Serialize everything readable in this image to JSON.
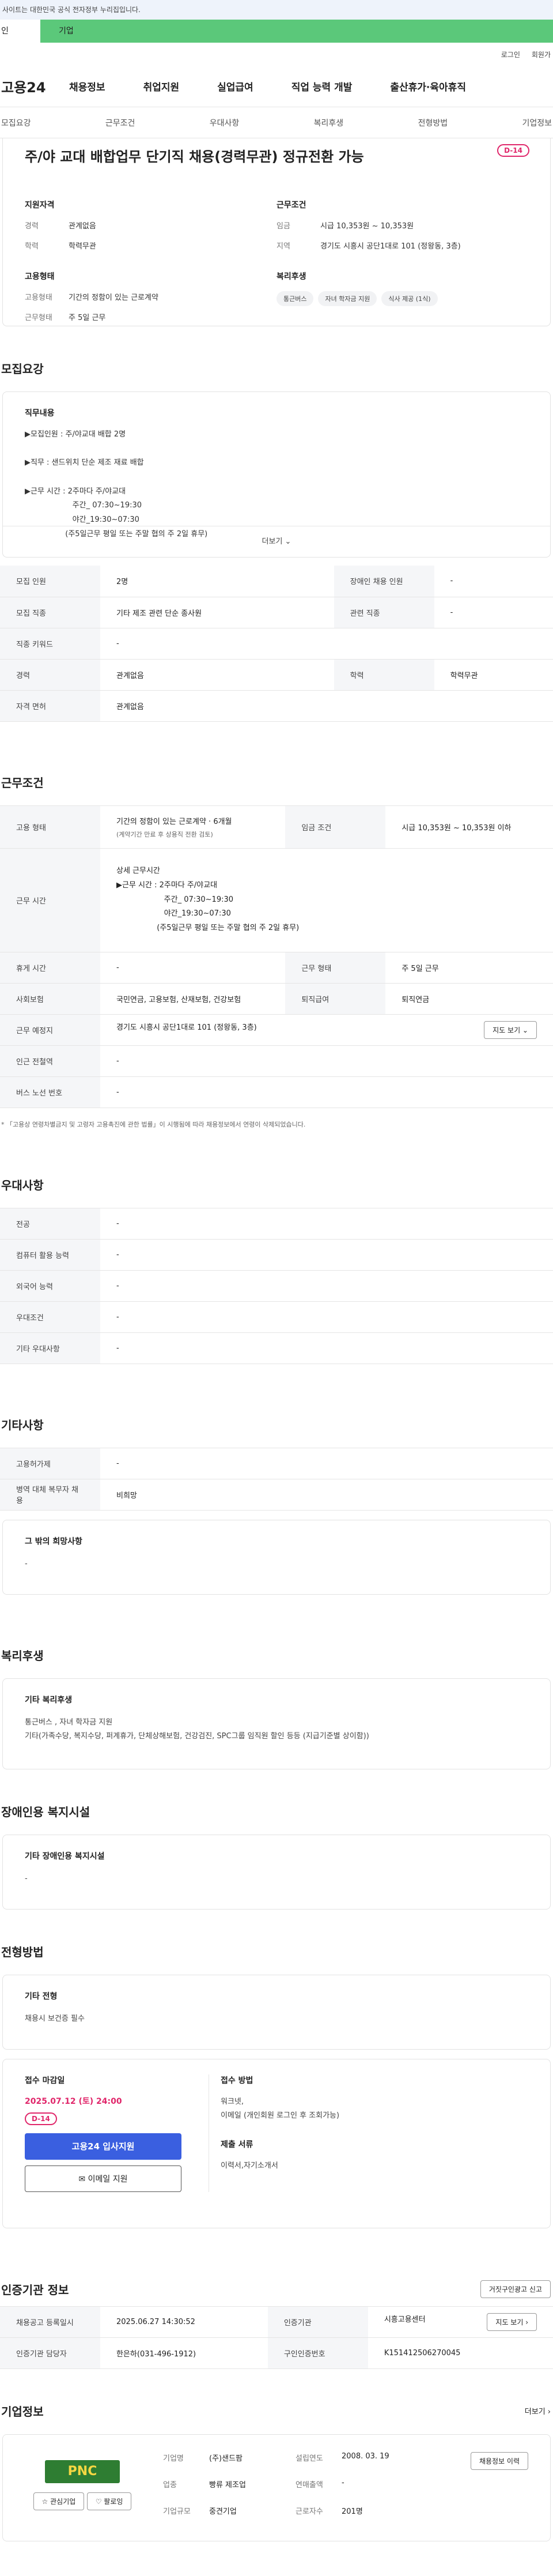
{
  "topbar": {
    "notice": "사이트는 대한민국 공식 전자정부 누리집입니다."
  },
  "site_tabs": {
    "left": "인",
    "right": "기업"
  },
  "utils": {
    "login": "로그인",
    "signup": "회원가"
  },
  "gnb": {
    "logo": "고용24",
    "menu": [
      "채용정보",
      "취업지원",
      "실업급여",
      "직업 능력 개발",
      "출산휴가·육아휴직"
    ]
  },
  "subnav": [
    "모집요강",
    "근무조건",
    "우대사항",
    "복리후생",
    "전형방법",
    "기업정보"
  ],
  "summary": {
    "title": "주/야 교대 배합업무 단기직 채용(경력무관) 정규전환 가능",
    "dday": "D-14",
    "left": {
      "qual_title": "지원자격",
      "qual": [
        {
          "k": "경력",
          "v": "관계없음"
        },
        {
          "k": "학력",
          "v": "학력무관"
        }
      ],
      "emp_title": "고용형태",
      "emp": [
        {
          "k": "고용형태",
          "v": "기간의 정함이 있는 근로계약"
        },
        {
          "k": "근무형태",
          "v": "주 5일 근무"
        }
      ]
    },
    "right": {
      "cond_title": "근무조건",
      "cond": [
        {
          "k": "임금",
          "v": "시급 10,353원 ~ 10,353원"
        },
        {
          "k": "지역",
          "v": "경기도 시흥시 공단1대로 101 (정왕동, 3층)"
        }
      ],
      "welfare_title": "복리후생",
      "chips": [
        "통근버스",
        "자녀 학자금 지원",
        "식사 제공 (1식)"
      ]
    }
  },
  "recruit": {
    "title": "모집요강",
    "job_h": "직무내용",
    "job_text": "▶모집인원 : 주/야교대 배합 2명\n\n▶직무 : 샌드위치 단순 제조 재료 배합\n\n▶근무 시간 : 2주마다 주/야교대\n                    주간_ 07:30~19:30\n                    야간_19:30~07:30\n                 (주5일근무 평일 또는 주말 협의 주 2일 휴무)",
    "more": "더보기 ⌄",
    "rows": [
      [
        "모집 인원",
        "2명",
        "장애인 채용 인원",
        "-"
      ],
      [
        "모집 직종",
        "기타 제조 관련 단순 종사원",
        "관련 직종",
        "-"
      ],
      [
        "직종 키워드",
        "-",
        "",
        ""
      ],
      [
        "경력",
        "관계없음",
        "학력",
        "학력무관"
      ],
      [
        "자격 면허",
        "관계없음",
        "",
        ""
      ]
    ]
  },
  "work": {
    "title": "근무조건",
    "emp_k": "고용 형태",
    "emp_v": "기간의 정함이 있는 근로계약 · 6개월",
    "emp_v2": "(계약기간 만료 후 상용직 전환 검토)",
    "wage_k": "임금 조건",
    "wage_v": "시급 10,353원 ~ 10,353원 이하",
    "time_k": "근무 시간",
    "time_v": "상세 근무시간\n▶근무 시간 : 2주마다 주/야교대\n                    주간_ 07:30~19:30\n                    야간_19:30~07:30\n                 (주5일근무 평일 또는 주말 협의 주 2일 휴무)",
    "rows": [
      [
        "휴게 시간",
        "-",
        "근무 형태",
        "주 5일 근무"
      ],
      [
        "사회보험",
        "국민연금, 고용보험, 산재보험, 건강보험",
        "퇴직급여",
        "퇴직연금"
      ]
    ],
    "place_k": "근무 예정지",
    "place_v": "경기도 시흥시 공단1대로 101 (정왕동, 3층)",
    "map_btn": "지도 보기 ⌄",
    "station_k": "인근 전철역",
    "station_v": "-",
    "bus_k": "버스 노선 번호",
    "bus_v": "-",
    "note": "* 「고용상 연령차별금지 및 고령자 고용촉진에 관한 법률」이 시행됨에 따라 채용정보에서 연령이 삭제되었습니다."
  },
  "pref": {
    "title": "우대사항",
    "rows": [
      [
        "전공",
        "-"
      ],
      [
        "컴퓨터 활용 능력",
        "-"
      ],
      [
        "외국어 능력",
        "-"
      ],
      [
        "우대조건",
        "-"
      ],
      [
        "기타 우대사항",
        "-"
      ]
    ]
  },
  "etc": {
    "title": "기타사항",
    "rows": [
      [
        "고용허가제",
        "-"
      ],
      [
        "병역 대체 복무자 채용",
        "비희망"
      ]
    ],
    "other_h": "그 밖의 희망사항",
    "other_v": "-"
  },
  "welfare": {
    "title": "복리후생",
    "h": "기타 복리후생",
    "text": "통근버스 , 자녀 학자금 지원\n기타(가족수당, 복지수당, 퍼계휴가, 단체상해보험, 건강검진, SPC그룹 임직원 할인 등등 (지급기준별 상이함))"
  },
  "disabled": {
    "title": "장애인용 복지시설",
    "h": "기타 장애인용 복지시설",
    "v": "-"
  },
  "selection": {
    "title": "전형방법",
    "h": "기타 전형",
    "v": "채용시 보건증 필수"
  },
  "apply": {
    "deadline_h": "접수 마감일",
    "deadline": "2025.07.12 (토) 24:00",
    "dday": "D-14",
    "apply_btn": "고용24 입사지원",
    "email_btn": "✉ 이메일 지원",
    "method_h": "접수 방법",
    "method": "워크넷,\n이메일 (개인회원 로그인 후 조회가능)",
    "docs_h": "제출 서류",
    "docs": "이력서,자기소개서"
  },
  "agency": {
    "title": "인증기관 정보",
    "report_btn": "거짓구인광고 신고",
    "rows": [
      [
        "채용공고 등록일시",
        "2025.06.27 14:30:52",
        "인증기관",
        "시흥고용센터"
      ],
      [
        "인증기관 담당자",
        "한은하(031-496-1912)",
        "구인인증번호",
        "K151412506270045"
      ]
    ],
    "map_btn": "지도 보기 ›"
  },
  "company": {
    "title": "기업정보",
    "more": "더보기 ›",
    "logo": "PNC",
    "fav_btn": "☆ 관심기업",
    "follow_btn": "♡ 팔로잉",
    "info": [
      [
        "기업명",
        "(주)샌드팜",
        "설립연도",
        "2008. 03. 19"
      ],
      [
        "업종",
        "빵류 제조업",
        "연매출액",
        "-"
      ],
      [
        "기업규모",
        "중견기업",
        "근로자수",
        "201명"
      ]
    ],
    "info_btn": "채용정보 이력"
  }
}
